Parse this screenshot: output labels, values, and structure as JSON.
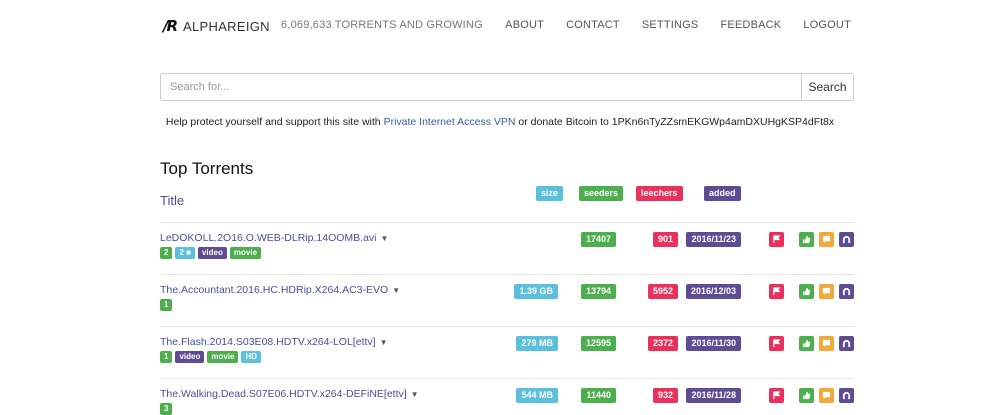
{
  "header": {
    "logo_mark": "/R",
    "logo_text": "ALPHAREIGN",
    "tagline": "6,069,633 TORRENTS AND GROWING",
    "nav": [
      "ABOUT",
      "CONTACT",
      "SETTINGS",
      "FEEDBACK",
      "LOGOUT"
    ]
  },
  "search": {
    "placeholder": "Search for...",
    "button_label": "Search"
  },
  "support": {
    "prefix": "Help protect yourself and support this site with ",
    "vpn_link": "Private Internet Access VPN",
    "middle": " or donate Bitcoin to ",
    "bitcoin": "1PKn6nTyZZsmEKGWp4amDXUHgKSP4dFt8x"
  },
  "list": {
    "heading": "Top Torrents",
    "col_title": "Title",
    "col_size": "size",
    "col_seeders": "seeders",
    "col_leechers": "leechers",
    "col_added": "added"
  },
  "rows": [
    {
      "name": "LeDOKOLL.2O16.O.WEB-DLRip.14OOMB.avi",
      "size": "",
      "seeders": "17407",
      "leechers": "901",
      "added": "2016/11/23",
      "tag_count": "2",
      "tag_comments": "2",
      "tag_video": "video",
      "tag_movie": "movie",
      "tag_hd": ""
    },
    {
      "name": "The.Accountant.2016.HC.HDRip.X264.AC3-EVO",
      "size": "1.39 GB",
      "seeders": "13794",
      "leechers": "5952",
      "added": "2016/12/03",
      "tag_count": "1",
      "tag_comments": "",
      "tag_video": "",
      "tag_movie": "",
      "tag_hd": ""
    },
    {
      "name": "The.Flash.2014.S03E08.HDTV.x264-LOL[ettv]",
      "size": "279 MB",
      "seeders": "12595",
      "leechers": "2372",
      "added": "2016/11/30",
      "tag_count": "1",
      "tag_comments": "",
      "tag_video": "video",
      "tag_movie": "movie",
      "tag_hd": "HD"
    },
    {
      "name": "The.Walking.Dead.S07E06.HDTV.x264-DEFiNE[ettv]",
      "size": "544 MB",
      "seeders": "11440",
      "leechers": "932",
      "added": "2016/11/28",
      "tag_count": "3",
      "tag_comments": "",
      "tag_video": "",
      "tag_movie": "",
      "tag_hd": ""
    }
  ],
  "icons": {
    "flag": "flag-icon",
    "like": "thumbs-up-icon",
    "comment": "comment-icon",
    "magnet": "magnet-icon"
  },
  "colors": {
    "link": "#4a4f9a",
    "info": "#5bc0de",
    "success": "#4cae4c",
    "danger": "#e8315d",
    "purple": "#5e4b94",
    "warning": "#f0a93a"
  }
}
